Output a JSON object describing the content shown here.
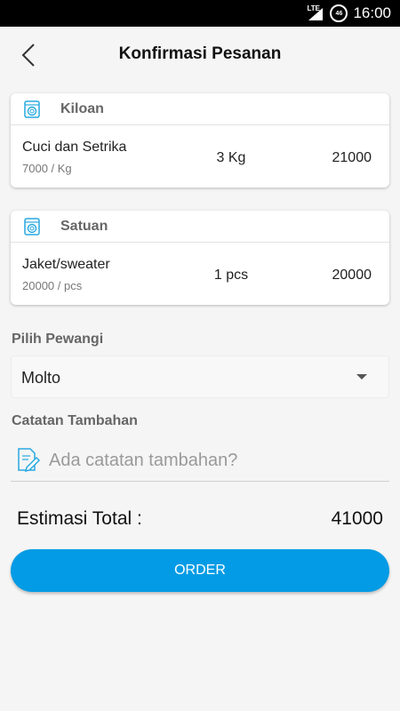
{
  "status_bar": {
    "network": "LTE",
    "battery_level": "46",
    "time": "16:00"
  },
  "header": {
    "title": "Konfirmasi Pesanan",
    "back_icon": "chevron-left-icon"
  },
  "orders": [
    {
      "category": "Kiloan",
      "icon": "washing-machine-icon",
      "item": {
        "name": "Cuci dan Setrika",
        "unit_price": "7000 / Kg",
        "quantity": "3 Kg",
        "price": "21000"
      }
    },
    {
      "category": "Satuan",
      "icon": "washing-machine-icon",
      "item": {
        "name": "Jaket/sweater",
        "unit_price": "20000 / pcs",
        "quantity": "1 pcs",
        "price": "20000"
      }
    }
  ],
  "fragrance": {
    "label": "Pilih Pewangi",
    "selected": "Molto"
  },
  "notes": {
    "label": "Catatan Tambahan",
    "placeholder": "Ada catatan tambahan?",
    "value": ""
  },
  "total": {
    "label": "Estimasi Total :",
    "value": "41000"
  },
  "order_button": {
    "label": "ORDER"
  },
  "colors": {
    "accent": "#039be5",
    "icon_blue": "#29a9e1",
    "background": "#f5f5f5"
  }
}
